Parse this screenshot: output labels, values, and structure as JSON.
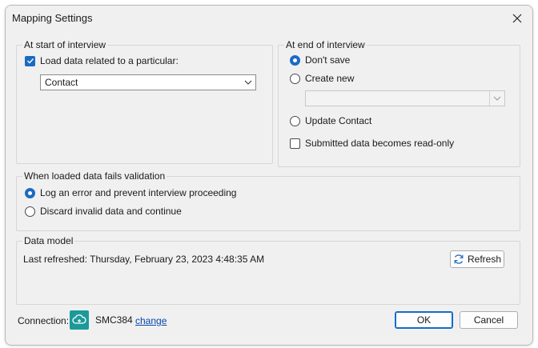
{
  "dialog": {
    "title": "Mapping Settings"
  },
  "start": {
    "legend": "At start of interview",
    "load_label": "Load data related to a particular:",
    "load_checked": true,
    "entity_value": "Contact"
  },
  "end": {
    "legend": "At end of interview",
    "dont_save": "Don't save",
    "create_new": "Create new",
    "create_new_value": "",
    "update_contact": "Update Contact",
    "readonly_label": "Submitted data becomes read-only",
    "selected": "dont_save"
  },
  "validation": {
    "legend": "When loaded data fails validation",
    "log_error": "Log an error and prevent interview proceeding",
    "discard": "Discard invalid data and continue",
    "selected": "log_error"
  },
  "data_model": {
    "legend": "Data model",
    "last_refreshed": "Last refreshed: Thursday, February 23, 2023 4:48:35 AM",
    "refresh_label": "Refresh"
  },
  "footer": {
    "connection_label": "Connection:",
    "connection_name": "SMC384",
    "change_link": "change",
    "ok_label": "OK",
    "cancel_label": "Cancel"
  },
  "colors": {
    "accent": "#1a6bc4",
    "link": "#0645ad",
    "connection_icon": "#1c9a9a"
  }
}
